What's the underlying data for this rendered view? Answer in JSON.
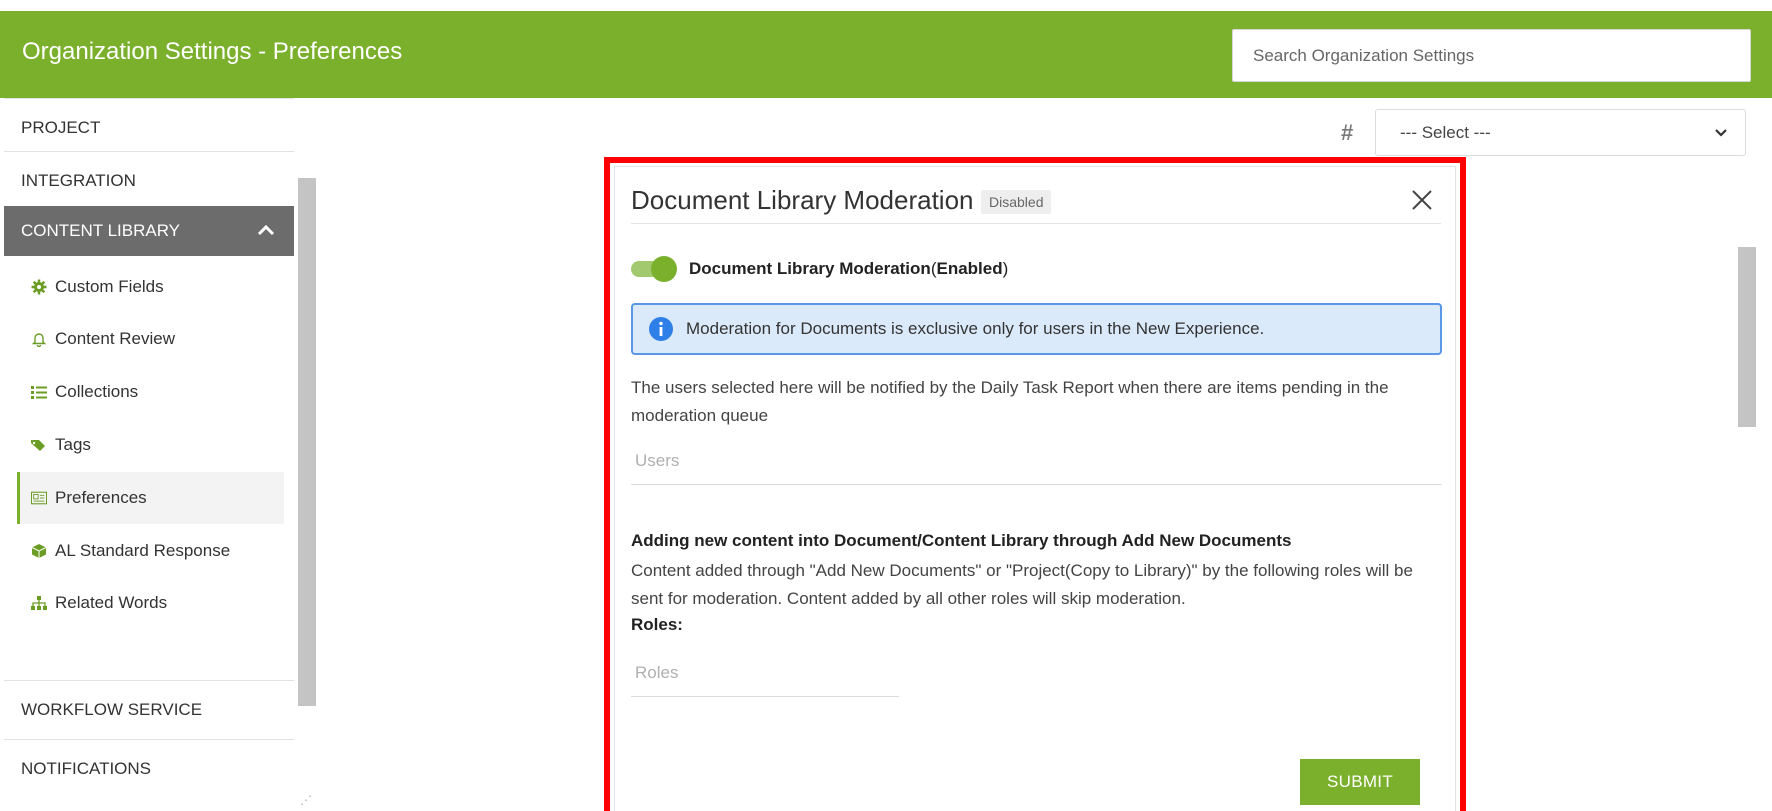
{
  "header": {
    "title": "Organization Settings - Preferences",
    "search_placeholder": "Search Organization Settings"
  },
  "sidebar": {
    "sections": [
      {
        "label": "PROJECT"
      },
      {
        "label": "INTEGRATION"
      },
      {
        "label": "CONTENT LIBRARY",
        "expanded": true
      },
      {
        "label": "WORKFLOW SERVICE"
      },
      {
        "label": "NOTIFICATIONS"
      }
    ],
    "items": [
      {
        "label": "Custom Fields",
        "icon": "gear-icon"
      },
      {
        "label": "Content Review",
        "icon": "bell-icon"
      },
      {
        "label": "Collections",
        "icon": "list-icon"
      },
      {
        "label": "Tags",
        "icon": "tags-icon"
      },
      {
        "label": "Preferences",
        "icon": "preferences-icon",
        "selected": true
      },
      {
        "label": "AL Standard Response",
        "icon": "cube-icon"
      },
      {
        "label": "Related Words",
        "icon": "sitemap-icon"
      }
    ]
  },
  "filter": {
    "hash_symbol": "#",
    "select_value": "--- Select ---"
  },
  "modal": {
    "title": "Document Library Moderation",
    "badge": "Disabled",
    "toggle": {
      "on": true,
      "label": "Document Library Moderation",
      "state_prefix": "(",
      "state": "Enabled",
      "state_suffix": ")"
    },
    "info_text": "Moderation for Documents is exclusive only for users in the New Experience.",
    "users_description": "The users selected here will be notified by the Daily Task Report when there are items pending in the moderation queue",
    "users_placeholder": "Users",
    "section_title": "Adding new content into Document/Content Library through Add New Documents",
    "section_description": "Content added through \"Add New Documents\" or \"Project(Copy to Library)\" by the following roles will be sent for moderation. Content added by all other roles will skip moderation.",
    "roles_label": "Roles:",
    "roles_placeholder": "Roles",
    "submit_label": "SUBMIT"
  },
  "colors": {
    "brand_green": "#7bb02c",
    "highlight_red": "#ff0000",
    "info_blue": "#5a97e6"
  }
}
